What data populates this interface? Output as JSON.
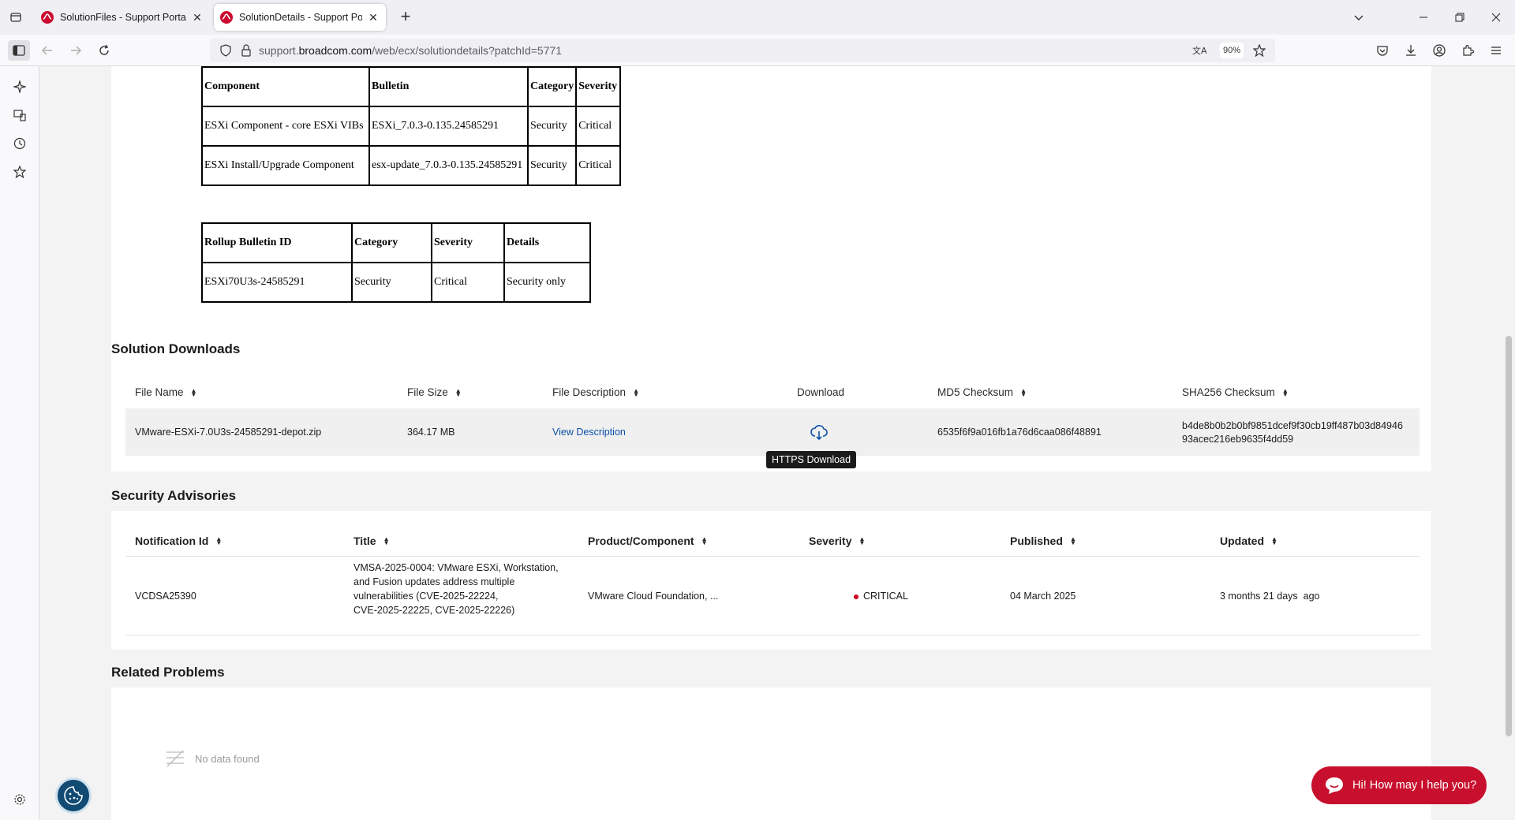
{
  "browser": {
    "tabs": [
      {
        "title": "SolutionFiles - Support Portal - ",
        "active": false
      },
      {
        "title": "SolutionDetails - Support Portal",
        "active": true
      }
    ],
    "url_prefix": "support.",
    "url_domain": "broadcom.com",
    "url_path": "/web/ecx/solutiondetails?patchId=5771",
    "zoom": "90%"
  },
  "bulletins": {
    "components_table": {
      "headers": [
        "Component",
        "Bulletin",
        "Category",
        "Severity"
      ],
      "rows": [
        [
          "ESXi Component - core ESXi VIBs",
          "ESXi_7.0.3-0.135.24585291",
          "Security",
          "Critical"
        ],
        [
          "ESXi Install/Upgrade Component",
          "esx-update_7.0.3-0.135.24585291",
          "Security",
          "Critical"
        ]
      ]
    },
    "rollup_table": {
      "headers": [
        "Rollup Bulletin ID",
        "Category",
        "Severity",
        "Details"
      ],
      "rows": [
        [
          "ESXi70U3s-24585291",
          "Security",
          "Critical",
          "Security only"
        ]
      ]
    }
  },
  "solution_downloads": {
    "title": "Solution Downloads",
    "headers": {
      "file_name": "File Name",
      "file_size": "File Size",
      "file_description": "File Description",
      "download": "Download",
      "md5": "MD5 Checksum",
      "sha256": "SHA256 Checksum"
    },
    "row": {
      "file_name": "VMware-ESXi-7.0U3s-24585291-depot.zip",
      "file_size": "364.17 MB",
      "file_description": "View Description",
      "md5": "6535f6f9a016fb1a76d6caa086f48891",
      "sha256_line1": "b4de8b0b2b0bf9851dcef9f30cb19ff487b03d84946",
      "sha256_line2": "93acec216eb9635f4dd59"
    },
    "tooltip": "HTTPS Download"
  },
  "security_advisories": {
    "title": "Security Advisories",
    "headers": {
      "notification_id": "Notification Id",
      "title": "Title",
      "product": "Product/Component",
      "severity": "Severity",
      "published": "Published",
      "updated": "Updated"
    },
    "row": {
      "notification_id": "VCDSA25390",
      "title_lines": [
        "VMSA-2025-0004: VMware ESXi, Workstation,",
        "and Fusion updates address multiple",
        "vulnerabilities (CVE-2025-22224,",
        "CVE-2025-22225, CVE-2025-22226)"
      ],
      "product": "VMware Cloud Foundation, ...",
      "severity": "CRITICAL",
      "severity_color": "#d0021b",
      "published": "04 March 2025",
      "updated": "3 months 21 days  ago"
    }
  },
  "related_problems": {
    "title": "Related Problems",
    "empty_text": "No data found"
  },
  "chat": {
    "label": "Hi! How may I help you?"
  },
  "colors": {
    "brand": "#c8102e",
    "link": "#0b4fa8",
    "cookie_button": "#114a72"
  }
}
